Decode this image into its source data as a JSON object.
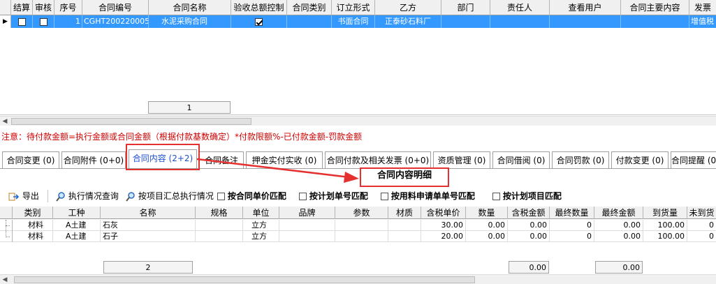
{
  "top_grid": {
    "columns": [
      "结算",
      "审核",
      "序号",
      "合同编号",
      "合同名称",
      "验收总额控制",
      "合同类别",
      "订立形式",
      "乙方",
      "部门",
      "责任人",
      "查看用户",
      "合同主要内容",
      "发票"
    ],
    "row": {
      "seq": "1",
      "contract_no": "CGHT200220005",
      "contract_name": "水泥采购合同",
      "form": "书面合同",
      "party_b": "正泰砂石料厂",
      "invoice": "增值税"
    },
    "footer_count": "1"
  },
  "note": "注意：待付款金额=执行金额或合同金额（根据付款基数确定）*付款限额%-已付款金额-罚款金额",
  "tabs": [
    "合同变更 (0)",
    "合同附件 (0+0)",
    "合同内容 (2+2)",
    "合同备注",
    "押金实付实收 (0)",
    "合同付款及相关发票 (0+0)",
    "资质管理 (0)",
    "合同借阅 (0)",
    "合同罚款 (0)",
    "付款变更 (0)",
    "合同提醒 (0)"
  ],
  "section_title": "合同内容明细",
  "toolbar": {
    "export": "导出",
    "exec_query": "执行情况查询",
    "by_item": "按项目汇总执行情况",
    "chk1": "按合同单价匹配",
    "chk2": "按计划单号匹配",
    "chk3": "按用料申请单单号匹配",
    "chk4": "按计划项目匹配"
  },
  "bottom_grid": {
    "columns": [
      "类别",
      "工种",
      "名称",
      "规格",
      "单位",
      "品牌",
      "参数",
      "材质",
      "含税单价",
      "数量",
      "含税金额",
      "最终数量",
      "最终金额",
      "到货量",
      "未到货"
    ],
    "rows": [
      {
        "cat": "材料",
        "type": "A土建",
        "name": "石灰",
        "spec": "",
        "unit": "立方",
        "brand": "",
        "param": "",
        "mat": "",
        "price": "30.00",
        "qty": "0.00",
        "amt": "0.00",
        "fqty": "0",
        "famt": "0.00",
        "arr": "100.00",
        "unarr": "0"
      },
      {
        "cat": "材料",
        "type": "A土建",
        "name": "石子",
        "spec": "",
        "unit": "立方",
        "brand": "",
        "param": "",
        "mat": "",
        "price": "20.00",
        "qty": "0.00",
        "amt": "0.00",
        "fqty": "0",
        "famt": "0.00",
        "arr": "100.00",
        "unarr": "0"
      }
    ],
    "footer_count": "2",
    "footer_amt": "0.00",
    "footer_famt": "0.00"
  },
  "colors": {
    "selection": "#3399ff",
    "note": "#d00000",
    "highlight": "#e53030"
  }
}
